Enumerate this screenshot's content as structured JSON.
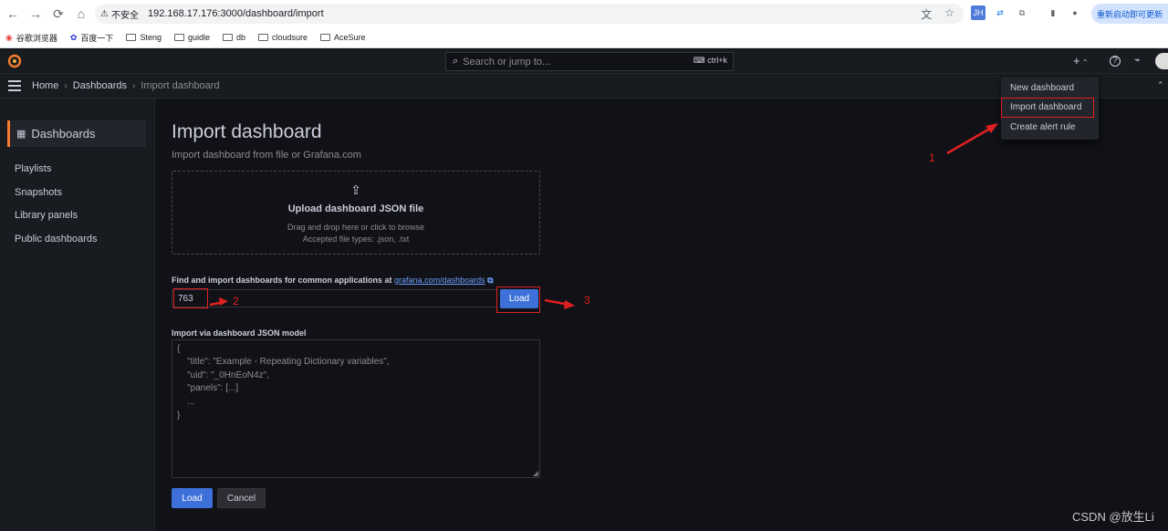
{
  "browser": {
    "back": "←",
    "forward": "→",
    "reload": "⟳",
    "home": "⌂",
    "security_label": "不安全",
    "url": "192.168.17.176:3000/dashboard/import",
    "update_label": "重新启动即可更新",
    "bookmarks": [
      "谷歌浏览器",
      "百度一下",
      "Steng",
      "guidle",
      "db",
      "cloudsure",
      "AceSure"
    ]
  },
  "topbar": {
    "search_placeholder": "Search or jump to...",
    "search_shortcut": "ctrl+k",
    "plus_label": "+",
    "help_label": "?",
    "news_label": "⌁"
  },
  "breadcrumb": {
    "home": "Home",
    "dashboards": "Dashboards",
    "current": "Import dashboard",
    "separator": "›"
  },
  "sidebar": {
    "title": "Dashboards",
    "items": [
      "Playlists",
      "Snapshots",
      "Library panels",
      "Public dashboards"
    ]
  },
  "main": {
    "title": "Import dashboard",
    "subtitle": "Import dashboard from file or Grafana.com",
    "upload": {
      "title": "Upload dashboard JSON file",
      "hint1": "Drag and drop here or click to browse",
      "hint2": "Accepted file types: .json, .txt"
    },
    "gcom_label": "Find and import dashboards for common applications at",
    "gcom_link": "grafana.com/dashboards",
    "gcom_value": "763",
    "load_label": "Load",
    "json_label": "Import via dashboard JSON model",
    "json_lines": [
      "{",
      "    \"title\": \"Example - Repeating Dictionary variables\",",
      "    \"uid\": \"_0HnEoN4z\",",
      "    \"panels\": [...]",
      "    ...",
      "}"
    ],
    "load_bottom_label": "Load",
    "cancel_label": "Cancel"
  },
  "menu": {
    "items": [
      "New dashboard",
      "Import dashboard",
      "Create alert rule"
    ]
  },
  "annotations": {
    "labels": [
      "1",
      "2",
      "3"
    ],
    "color": "#e02020"
  },
  "watermark": "CSDN @放生Li",
  "colors": {
    "accent": "#3d71d9",
    "brand": "#f77c2b",
    "background": "#111217",
    "panel": "#181b1f"
  }
}
